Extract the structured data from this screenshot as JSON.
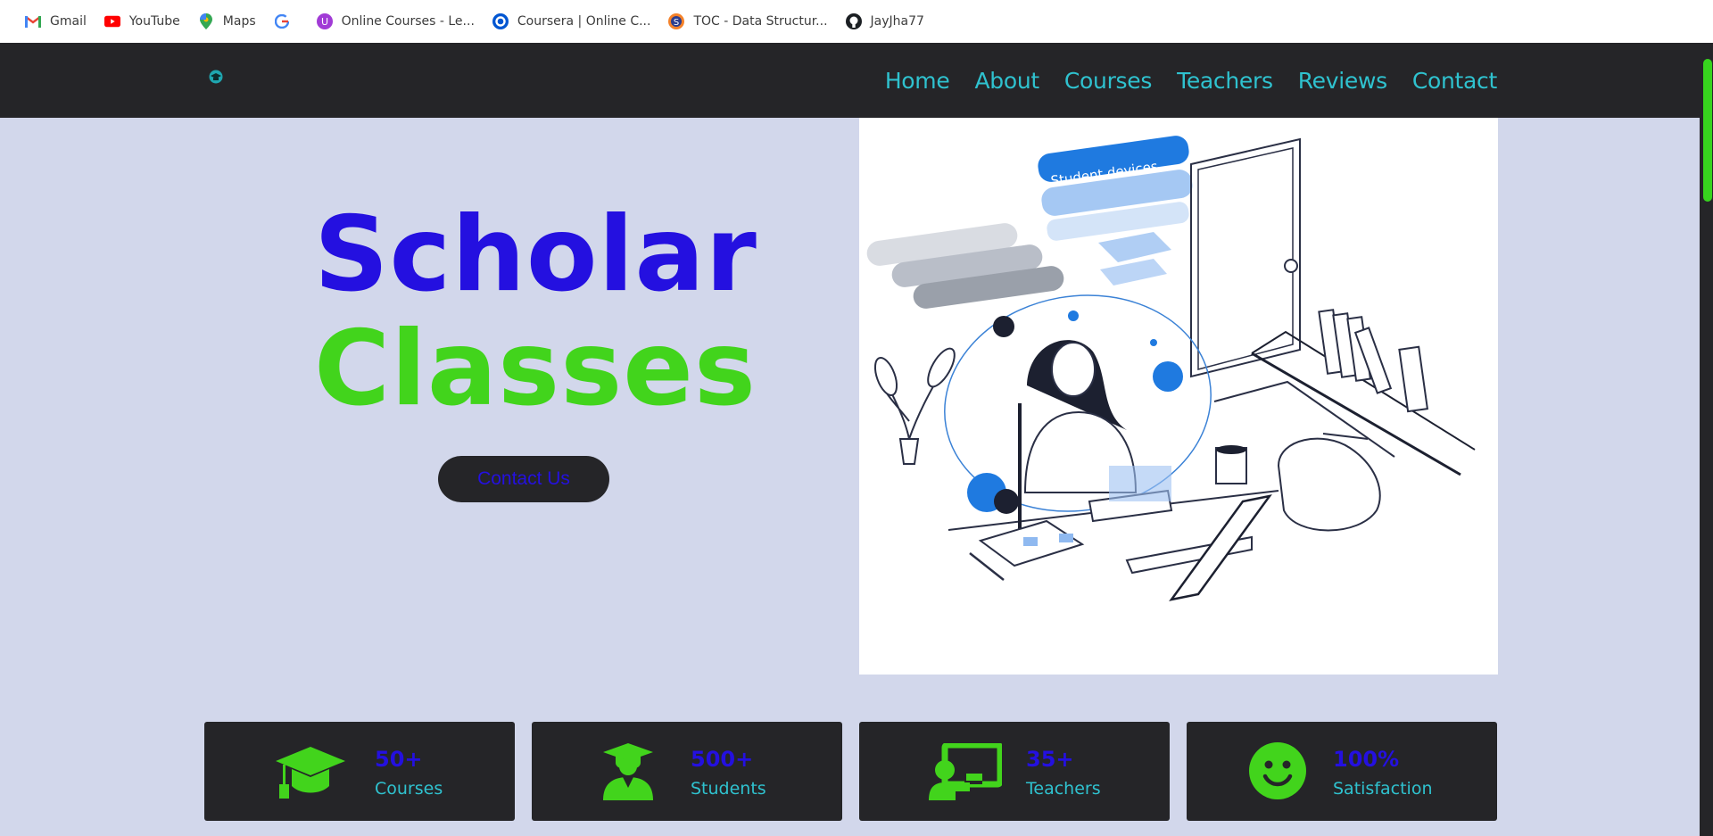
{
  "bookmarks": [
    {
      "label": "Gmail",
      "icon": "gmail-icon"
    },
    {
      "label": "YouTube",
      "icon": "youtube-icon"
    },
    {
      "label": "Maps",
      "icon": "maps-icon"
    },
    {
      "label": "",
      "icon": "google-icon"
    },
    {
      "label": "Online Courses - Le...",
      "icon": "online-courses-icon"
    },
    {
      "label": "Coursera | Online C...",
      "icon": "coursera-icon"
    },
    {
      "label": "TOC - Data Structur...",
      "icon": "toc-icon"
    },
    {
      "label": "JayJha77",
      "icon": "github-icon"
    }
  ],
  "nav": {
    "logo": "graduation-cap-logo-icon",
    "items": [
      "Home",
      "About",
      "Courses",
      "Teachers",
      "Reviews",
      "Contact"
    ]
  },
  "hero": {
    "title_line1": "Scholar",
    "title_line2": "Classes",
    "cta": "Contact Us",
    "illustration_text": "Student devices"
  },
  "stats": [
    {
      "number": "50+",
      "label": "Courses",
      "icon": "graduation-cap-icon"
    },
    {
      "number": "500+",
      "label": "Students",
      "icon": "student-icon"
    },
    {
      "number": "35+",
      "label": "Teachers",
      "icon": "teacher-icon"
    },
    {
      "number": "100%",
      "label": "Satisfaction",
      "icon": "smile-icon"
    }
  ],
  "colors": {
    "nav_bg": "#252528",
    "page_bg": "#d2d7eb",
    "primary_blue": "#2410e0",
    "accent_green": "#42d41c",
    "link_teal": "#2fc2cf"
  }
}
